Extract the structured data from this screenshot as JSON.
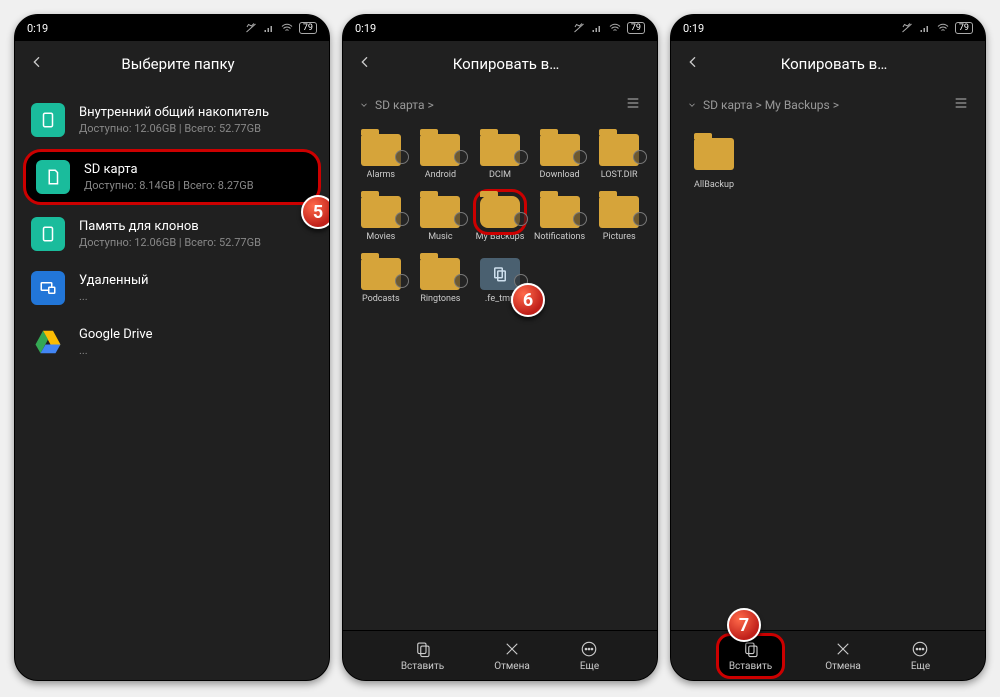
{
  "status": {
    "time": "0:19",
    "battery": "79"
  },
  "screen1": {
    "title": "Выберите папку",
    "callout": "5",
    "items": [
      {
        "name": "Внутренний общий накопитель",
        "sub": "Доступно: 12.06GB | Всего: 52.77GB",
        "icon": "green",
        "highlight": false
      },
      {
        "name": "SD карта",
        "sub": "Доступно: 8.14GB | Всего: 8.27GB",
        "icon": "green",
        "highlight": true
      },
      {
        "name": "Память для клонов",
        "sub": "Доступно: 12.06GB | Всего: 52.77GB",
        "icon": "green",
        "highlight": false
      },
      {
        "name": "Удаленный",
        "sub": "...",
        "icon": "blue",
        "highlight": false
      },
      {
        "name": "Google Drive",
        "sub": "...",
        "icon": "gdrive",
        "highlight": false
      }
    ]
  },
  "screen2": {
    "title": "Копировать в…",
    "callout": "6",
    "breadcrumb": "SD карта >",
    "folders": [
      {
        "label": "Alarms",
        "type": "folder"
      },
      {
        "label": "Android",
        "type": "folder"
      },
      {
        "label": "DCIM",
        "type": "folder"
      },
      {
        "label": "Download",
        "type": "folder"
      },
      {
        "label": "LOST.DIR",
        "type": "folder"
      },
      {
        "label": "Movies",
        "type": "folder"
      },
      {
        "label": "Music",
        "type": "folder"
      },
      {
        "label": "My Backups",
        "type": "folder",
        "highlight": true
      },
      {
        "label": "Notifications",
        "type": "folder"
      },
      {
        "label": "Pictures",
        "type": "folder"
      },
      {
        "label": "Podcasts",
        "type": "folder"
      },
      {
        "label": "Ringtones",
        "type": "folder"
      },
      {
        "label": ".fe_tmp",
        "type": "file"
      }
    ],
    "bottom": {
      "paste": "Вставить",
      "cancel": "Отмена",
      "more": "Еще"
    }
  },
  "screen3": {
    "title": "Копировать в…",
    "callout": "7",
    "breadcrumb": "SD карта > My Backups >",
    "folders": [
      {
        "label": "AllBackup",
        "type": "folder"
      }
    ],
    "bottom": {
      "paste": "Вставить",
      "cancel": "Отмена",
      "more": "Еще"
    }
  }
}
